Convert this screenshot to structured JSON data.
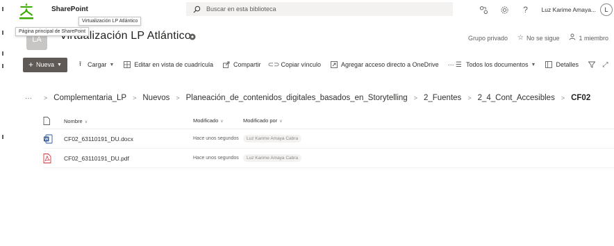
{
  "suite_bar": {
    "app_name": "SharePoint",
    "search_placeholder": "Buscar en esta biblioteca",
    "user_name": "Luz Karime Amaya...",
    "user_initial": "L"
  },
  "tooltips": {
    "site": "Virtualización LP Atlántico",
    "home": "Página principal de SharePoint"
  },
  "site": {
    "logo_text": "LA",
    "title": "Virtualización LP Atlántico",
    "privacy": "Grupo privado",
    "follow": "No se sigue",
    "members": "1 miembro"
  },
  "command_bar": {
    "new_label": "Nueva",
    "upload_label": "Cargar",
    "grid_edit_label": "Editar en vista de cuadrícula",
    "share_label": "Compartir",
    "copy_link_label": "Copiar vínculo",
    "onedrive_label": "Agregar acceso directo a OneDrive",
    "more_label": "···",
    "view_label": "Todos los documentos",
    "details_label": "Detalles"
  },
  "breadcrumb": {
    "more": "···",
    "items": [
      "Complementaria_LP",
      "Nuevos",
      "Planeación_de_contenidos_digitales_basados_en_Storytelling",
      "2_Fuentes",
      "2_4_Cont_Accesibles"
    ],
    "current": "CF02"
  },
  "file_list": {
    "headers": {
      "name": "Nombre",
      "modified": "Modificado",
      "modified_by": "Modificado por"
    },
    "rows": [
      {
        "type": "docx",
        "name": "CF02_63110191_DU.docx",
        "modified": "Hace unos segundos",
        "modified_by": "Luz Karime Amaya Cabra"
      },
      {
        "type": "pdf",
        "name": "CF02_63110191_DU.pdf",
        "modified": "Hace unos segundos",
        "modified_by": "Luz Karime Amaya Cabra"
      }
    ]
  },
  "colors": {
    "new_button": "#5f5a55",
    "word_blue": "#2b579a",
    "pdf_red": "#d13438",
    "logo_green": "#39a900"
  },
  "icons": [
    "sharepoint-logo-icon",
    "search-icon",
    "share-icon",
    "settings-icon",
    "help-icon",
    "star-icon",
    "person-icon",
    "upload-icon",
    "grid-icon",
    "share-link-icon",
    "link-icon",
    "onedrive-icon",
    "filter-icon",
    "expand-icon",
    "doc-icon",
    "word-icon",
    "pdf-icon"
  ]
}
